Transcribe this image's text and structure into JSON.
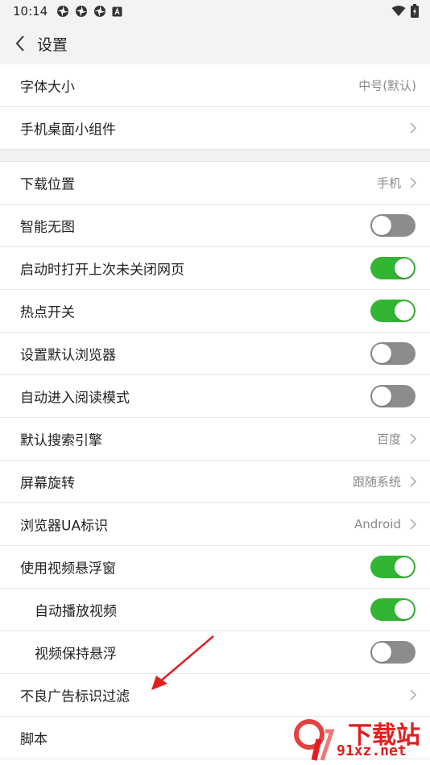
{
  "status_bar": {
    "time": "10:14"
  },
  "header": {
    "title": "设置"
  },
  "rows_group1": [
    {
      "label": "字体大小",
      "value": "中号(默认)"
    },
    {
      "label": "手机桌面小组件",
      "value": ""
    }
  ],
  "rows_group2": [
    {
      "label": "下载位置",
      "value": "手机"
    },
    {
      "label": "智能无图",
      "toggle": "off"
    },
    {
      "label": "启动时打开上次未关闭网页",
      "toggle": "on"
    },
    {
      "label": "热点开关",
      "toggle": "on"
    },
    {
      "label": "设置默认浏览器",
      "toggle": "off"
    },
    {
      "label": "自动进入阅读模式",
      "toggle": "off"
    },
    {
      "label": "默认搜索引擎",
      "value": "百度"
    },
    {
      "label": "屏幕旋转",
      "value": "跟随系统"
    },
    {
      "label": "浏览器UA标识",
      "value": "Android"
    },
    {
      "label": "使用视频悬浮窗",
      "toggle": "on"
    },
    {
      "label": "自动播放视频",
      "toggle": "on"
    },
    {
      "label": "视频保持悬浮",
      "toggle": "off"
    },
    {
      "label": "不良广告标识过滤",
      "value": ""
    },
    {
      "label": "脚本",
      "value": ""
    }
  ],
  "watermark": {
    "line1": "下载站",
    "line2": "91xz.net"
  },
  "colors": {
    "toggle_on": "#32b532",
    "toggle_off": "#8c8c8c",
    "header_bg": "#f3f3f3",
    "annotation_arrow": "#e21e1e"
  }
}
